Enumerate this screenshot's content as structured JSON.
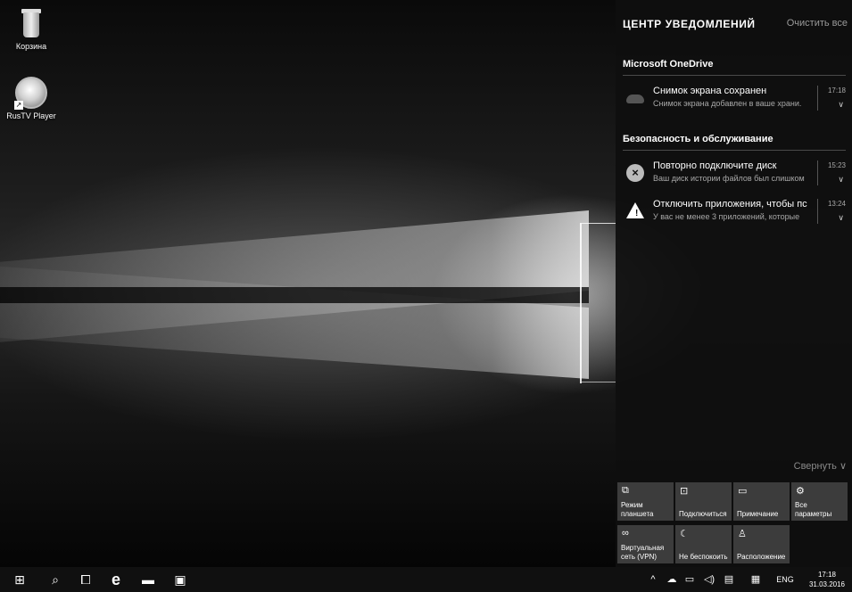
{
  "desktop": {
    "icons": [
      {
        "label": "Корзина",
        "icon": "recycle-bin-icon"
      },
      {
        "label": "RusTV Player",
        "icon": "rustv-player-icon"
      }
    ]
  },
  "action_center": {
    "title": "ЦЕНТР УВЕДОМЛЕНИЙ",
    "clear_all": "Очистить все",
    "groups": [
      {
        "name": "Microsoft OneDrive",
        "notifications": [
          {
            "title": "Снимок экрана сохранен",
            "body": "Снимок экрана добавлен в ваше храни.",
            "time": "17:18",
            "icon": "onedrive-cloud-icon"
          }
        ]
      },
      {
        "name": "Безопасность и обслуживание",
        "notifications": [
          {
            "title": "Повторно подключите диск",
            "body": "Ваш диск истории файлов был слишком",
            "time": "15:23",
            "icon": "error-x-icon"
          },
          {
            "title": "Отключить приложения, чтобы пс",
            "body": "У вас не менее 3 приложений, которые",
            "time": "13:24",
            "icon": "warning-icon"
          }
        ]
      }
    ],
    "collapse": "Свернуть ∨",
    "quick_actions": [
      {
        "label": "Режим планшета",
        "icon": "⧉"
      },
      {
        "label": "Подключиться",
        "icon": "⊡"
      },
      {
        "label": "Примечание",
        "icon": "▭"
      },
      {
        "label": "Все параметры",
        "icon": "⚙"
      },
      {
        "label": "Виртуальная сеть (VPN)",
        "icon": "∞"
      },
      {
        "label": "Не беспокоить",
        "icon": "☾"
      },
      {
        "label": "Расположение",
        "icon": "♙"
      }
    ]
  },
  "taskbar": {
    "start": "⊞",
    "search": "⌕",
    "task_view": "⧠",
    "edge": "e",
    "explorer": "▬",
    "store": "▣",
    "tray": {
      "chevron": "^",
      "onedrive": "☁",
      "network": "▭",
      "volume": "◁)",
      "notifications": "▤",
      "keyboard": "▦",
      "language": "ENG"
    },
    "time": "17:18",
    "date": "31.03.2016"
  }
}
